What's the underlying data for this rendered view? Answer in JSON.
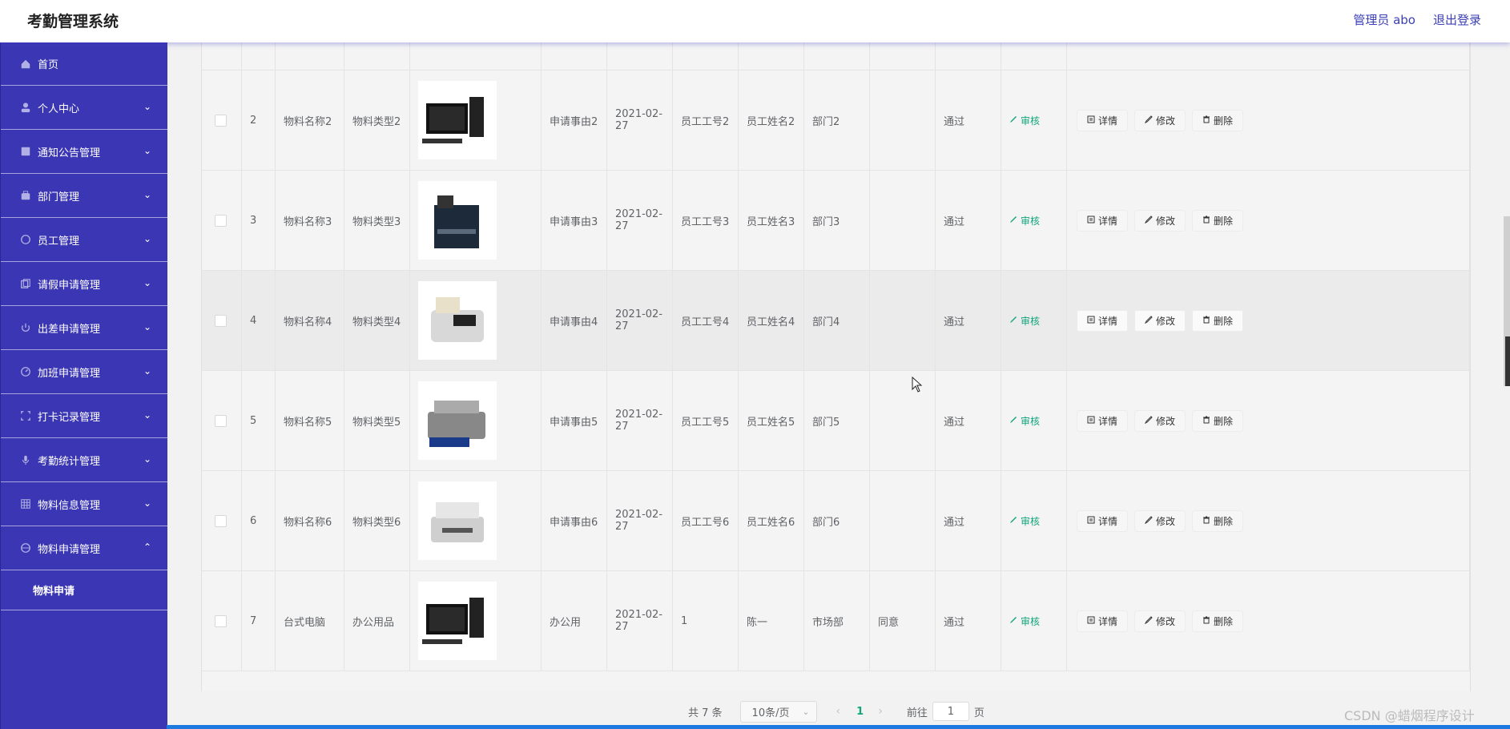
{
  "app_title": "考勤管理系统",
  "header": {
    "user_label": "管理员 abo",
    "logout_label": "退出登录"
  },
  "sidebar": {
    "items": [
      {
        "label": "首页",
        "icon": "home-icon"
      },
      {
        "label": "个人中心",
        "icon": "user-icon"
      },
      {
        "label": "通知公告管理",
        "icon": "notice-icon"
      },
      {
        "label": "部门管理",
        "icon": "briefcase-icon"
      },
      {
        "label": "员工管理",
        "icon": "compass-icon"
      },
      {
        "label": "请假申请管理",
        "icon": "copy-icon"
      },
      {
        "label": "出差申请管理",
        "icon": "power-icon"
      },
      {
        "label": "加班申请管理",
        "icon": "gauge-icon"
      },
      {
        "label": "打卡记录管理",
        "icon": "scan-icon"
      },
      {
        "label": "考勤统计管理",
        "icon": "mic-icon"
      },
      {
        "label": "物料信息管理",
        "icon": "grid-icon"
      },
      {
        "label": "物料申请管理",
        "icon": "globe-icon"
      }
    ],
    "sub_item": "物料申请"
  },
  "table": {
    "rows": [
      {
        "no": "2",
        "name": "物料名称2",
        "type": "物料类型2",
        "image": "desktop-computer",
        "reason": "申请事由2",
        "date": "2021-02-27",
        "emp_no": "员工工号2",
        "emp_name": "员工姓名2",
        "dept": "部门2",
        "reply": "",
        "status": "通过"
      },
      {
        "no": "3",
        "name": "物料名称3",
        "type": "物料类型3",
        "image": "copier",
        "reason": "申请事由3",
        "date": "2021-02-27",
        "emp_no": "员工工号3",
        "emp_name": "员工姓名3",
        "dept": "部门3",
        "reply": "",
        "status": "通过"
      },
      {
        "no": "4",
        "name": "物料名称4",
        "type": "物料类型4",
        "image": "money-counter",
        "reason": "申请事由4",
        "date": "2021-02-27",
        "emp_no": "员工工号4",
        "emp_name": "员工姓名4",
        "dept": "部门4",
        "reply": "",
        "status": "通过"
      },
      {
        "no": "5",
        "name": "物料名称5",
        "type": "物料类型5",
        "image": "printer",
        "reason": "申请事由5",
        "date": "2021-02-27",
        "emp_no": "员工工号5",
        "emp_name": "员工姓名5",
        "dept": "部门5",
        "reply": "",
        "status": "通过"
      },
      {
        "no": "6",
        "name": "物料名称6",
        "type": "物料类型6",
        "image": "scanner",
        "reason": "申请事由6",
        "date": "2021-02-27",
        "emp_no": "员工工号6",
        "emp_name": "员工姓名6",
        "dept": "部门6",
        "reply": "",
        "status": "通过"
      },
      {
        "no": "7",
        "name": "台式电脑",
        "type": "办公用品",
        "image": "desktop-computer",
        "reason": "办公用",
        "date": "2021-02-27",
        "emp_no": "1",
        "emp_name": "陈一",
        "dept": "市场部",
        "reply": "同意",
        "status": "通过"
      }
    ],
    "audit_label": "审核",
    "detail_label": "详情",
    "edit_label": "修改",
    "delete_label": "删除"
  },
  "pagination": {
    "total": "共 7 条",
    "page_size": "10条/页",
    "current_page": "1",
    "goto_prefix": "前往",
    "goto_value": "1",
    "goto_suffix": "页"
  },
  "watermark": "CSDN @蜡烟程序设计"
}
